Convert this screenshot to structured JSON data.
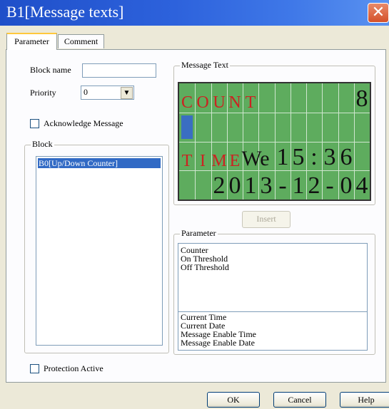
{
  "window": {
    "title": "B1[Message texts]",
    "close_label": "✕"
  },
  "tabs": [
    {
      "label": "Parameter",
      "active": true
    },
    {
      "label": "Comment",
      "active": false
    }
  ],
  "form": {
    "block_name_label": "Block name",
    "block_name_value": "",
    "priority_label": "Priority",
    "priority_value": "0",
    "acknowledge_label": "Acknowledge Message",
    "acknowledge_checked": false,
    "protection_label": "Protection Active",
    "protection_checked": false
  },
  "block_group": {
    "title": "Block",
    "items": [
      "B0[Up/Down Counter]"
    ],
    "selected": 0
  },
  "message_group": {
    "title": "Message Text",
    "lcd": {
      "rows": [
        [
          "C",
          "O",
          "U",
          "N",
          "T",
          "",
          "",
          "",
          "",
          "",
          "",
          "8"
        ],
        [
          "",
          "",
          "",
          "",
          "",
          "",
          "",
          "",
          "",
          "",
          "",
          ""
        ],
        [
          "T",
          "I",
          "M",
          "E",
          "We",
          "",
          "1",
          "5",
          ":",
          "3",
          "6",
          ""
        ],
        [
          "",
          "",
          "2",
          "0",
          "1",
          "3",
          "-",
          "1",
          "2",
          "-",
          "0",
          "4"
        ]
      ],
      "red_chars": "Row 1 cells 1-5 and row 3 cells 1-4 are red",
      "cursor": {
        "row": 2,
        "col": 1
      },
      "colors": {
        "background": "#5eac5e",
        "red_text": "#cc2222",
        "dark_text": "#111111",
        "grid": "#cfe6cf",
        "cursor": "#3a6ec2"
      }
    }
  },
  "insert_button": "Insert",
  "parameter_group": {
    "title": "Parameter",
    "list_items": [
      "Counter",
      "On Threshold",
      "Off Threshold"
    ],
    "extra_items": [
      "Current Time",
      "Current Date",
      "Message Enable Time",
      "Message Enable Date"
    ]
  },
  "buttons": {
    "ok": "OK",
    "cancel": "Cancel",
    "help": "Help"
  },
  "colors": {
    "title_bar": "#2d62dc",
    "dialog_bg": "#ece9d8",
    "selection": "#316ac5"
  }
}
